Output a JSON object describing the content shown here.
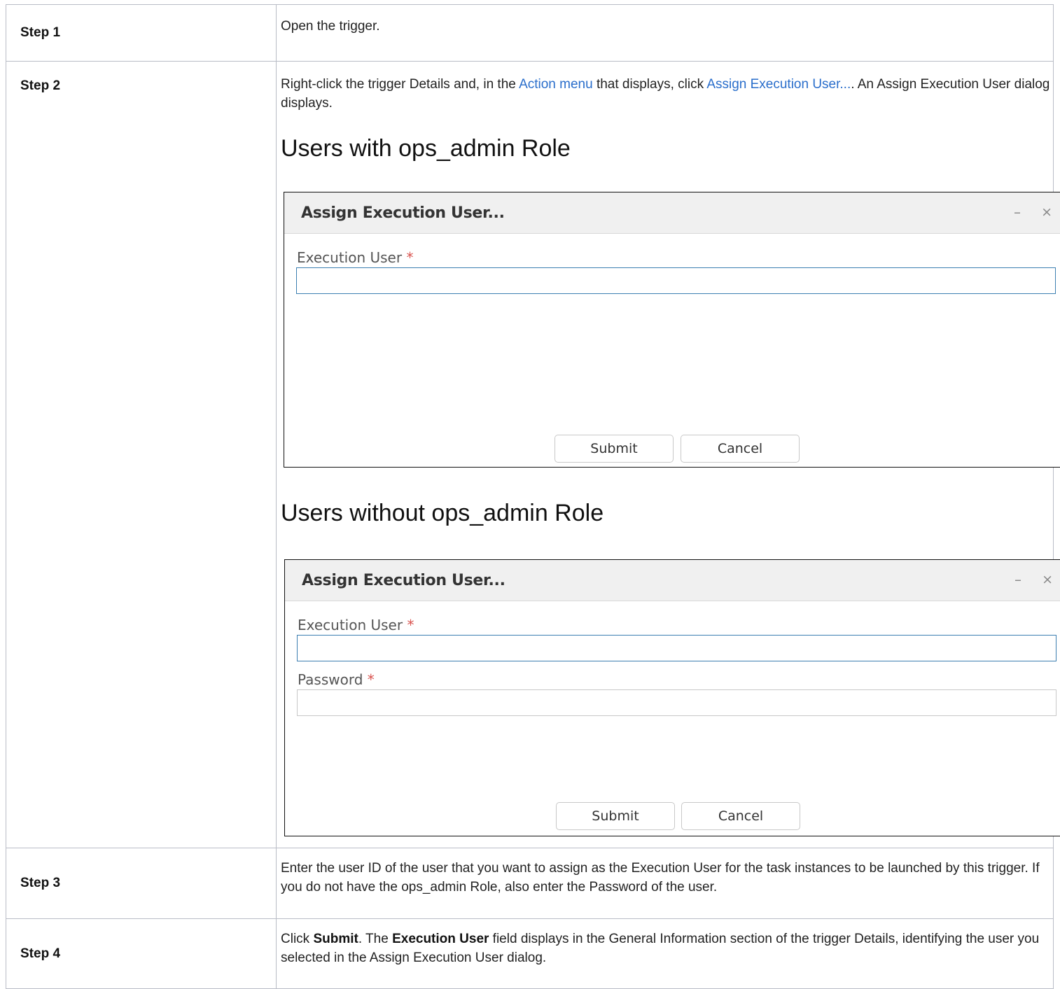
{
  "steps": [
    {
      "label": "Step 1",
      "text": "Open the trigger."
    },
    {
      "label": "Step 2",
      "text_before": "Right-click the trigger Details and, in the ",
      "link1": "Action menu",
      "text_middle": " that displays, click ",
      "link2": "Assign Execution User...",
      "text_after": ". An Assign Execution User dialog displays.",
      "heading_with": "Users with ops_admin Role",
      "heading_without": "Users without ops_admin Role"
    },
    {
      "label": "Step 3",
      "text": "Enter the user ID of the user that you want to assign as the Execution User for the task instances to be launched by this trigger. If you do not have the ops_admin Role, also enter the Password of the user."
    },
    {
      "label": "Step 4",
      "text_click": "Click ",
      "bold_submit": "Submit",
      "text_the": ". The ",
      "bold_field": "Execution User",
      "text_rest": " field displays in the General Information section of the trigger Details, identifying the user you selected in the Assign Execution User dialog."
    }
  ],
  "dialog": {
    "title": "Assign Execution User...",
    "minimize_glyph": "–",
    "close_glyph": "×",
    "execution_user_label": "Execution User",
    "password_label": "Password",
    "required_mark": "*",
    "submit_label": "Submit",
    "cancel_label": "Cancel"
  }
}
